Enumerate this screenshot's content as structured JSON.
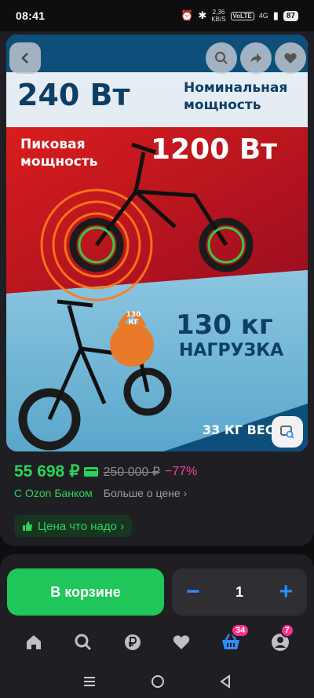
{
  "status_bar": {
    "time": "08:41",
    "net_speed_value": "2,36",
    "net_speed_unit": "KB/S",
    "volte": "VoLTE",
    "network": "4G",
    "battery": "87"
  },
  "product_image": {
    "power_value": "240 Вт",
    "power_label_line1": "Номинальная",
    "power_label_line2": "мощность",
    "peak_label_line1": "Пиковая",
    "peak_label_line2": "мощность",
    "peak_value": "1200 Вт",
    "kettlebell_label": "130 КГ",
    "load_value": "130 кг",
    "load_label": "НАГРУЗКА",
    "weight_label": "33 КГ ВЕС"
  },
  "price": {
    "current": "55 698 ₽",
    "old": "250 000 ₽",
    "discount": "−77%",
    "bank_label": "С Ozon Банком",
    "more_label": "Больше о цене ›",
    "badge_label": "Цена что надо ›"
  },
  "cart": {
    "button_label": "В корзине",
    "minus": "−",
    "quantity": "1",
    "plus": "+"
  },
  "tabbar": {
    "cart_badge": "34",
    "profile_badge": "7"
  },
  "colors": {
    "accent_green": "#1fc65a",
    "price_green": "#2bd35a",
    "discount_pink": "#ff3ea5",
    "stepper_blue": "#2f8cff",
    "badge_pink": "#ff2e8b"
  },
  "icons": [
    "back-icon",
    "search-icon",
    "share-icon",
    "heart-icon",
    "image-search-icon",
    "home-icon",
    "catalog-search-icon",
    "ruble-icon",
    "favorites-icon",
    "cart-icon",
    "profile-icon"
  ]
}
